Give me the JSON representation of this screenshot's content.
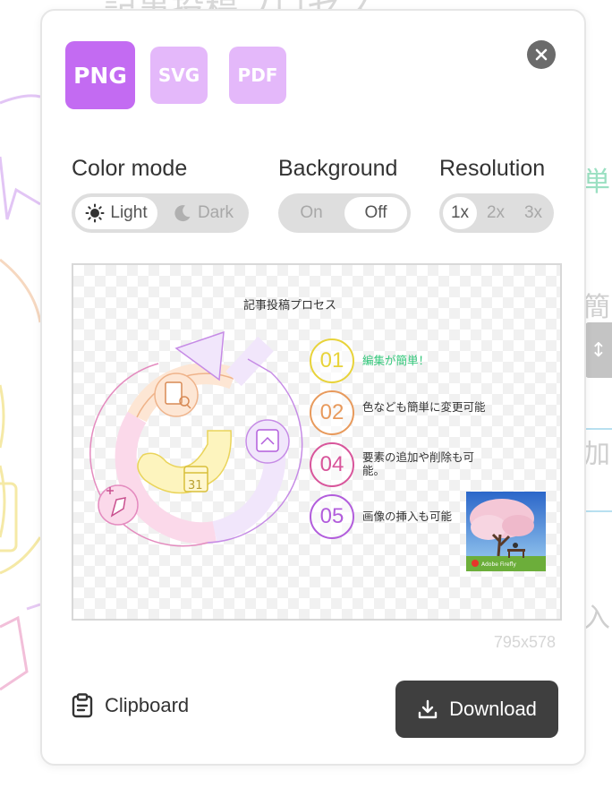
{
  "background_page": {
    "title_fragment": "記事投稿プロセス",
    "side_chars": [
      "単",
      "簡",
      "加",
      "入"
    ]
  },
  "export_dialog": {
    "formats": [
      {
        "label": "PNG",
        "selected": true
      },
      {
        "label": "SVG",
        "selected": false
      },
      {
        "label": "PDF",
        "selected": false
      }
    ],
    "close_icon": "close-icon",
    "color_mode": {
      "label": "Color mode",
      "options": [
        "Light",
        "Dark"
      ],
      "selected": "Light"
    },
    "background": {
      "label": "Background",
      "options": [
        "On",
        "Off"
      ],
      "selected": "Off"
    },
    "resolution": {
      "label": "Resolution",
      "options": [
        "1x",
        "2x",
        "3x"
      ],
      "selected": "1x"
    },
    "preview": {
      "title": "記事投稿プロセス",
      "steps": [
        {
          "number": "01",
          "text": "編集が簡単！",
          "color": "#e8d33a",
          "text_color": "#34c77b"
        },
        {
          "number": "02",
          "text": "色なども簡単に変更可能",
          "color": "#e89a5c",
          "text_color": "#333333"
        },
        {
          "number": "04",
          "text": "要素の追加や削除も可能。",
          "color": "#d8559b",
          "text_color": "#333333"
        },
        {
          "number": "05",
          "text": "画像の挿入も可能",
          "color": "#b25ddc",
          "text_color": "#333333"
        }
      ],
      "calendar_number": "31",
      "photo_caption": "Adobe Firefly"
    },
    "dimensions": "795x578",
    "clipboard_label": "Clipboard",
    "download_label": "Download",
    "colors": {
      "accent": "#c36bf2",
      "accent_light": "#e4b8fa",
      "download_bg": "#3f3f3f"
    }
  }
}
